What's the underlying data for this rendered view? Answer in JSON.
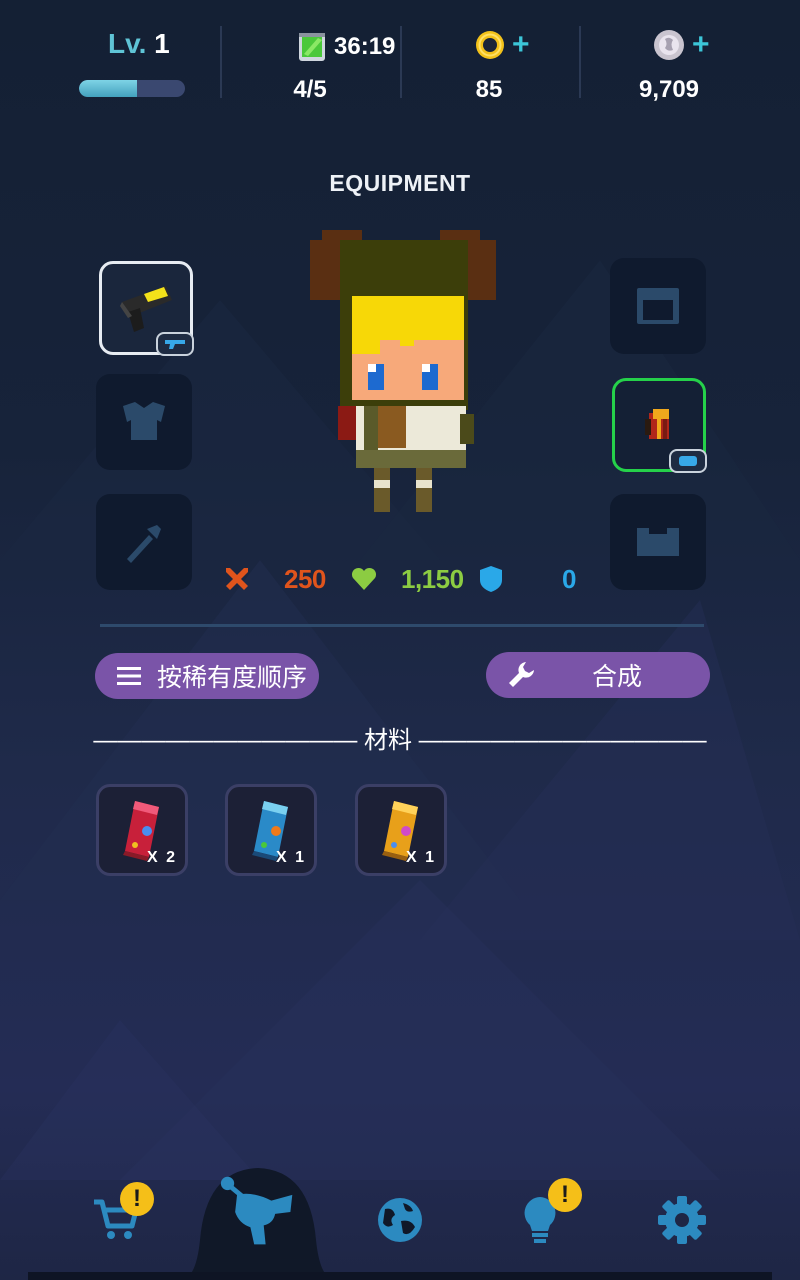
{
  "header": {
    "level_prefix": "Lv.",
    "level_value": "1",
    "xp_progress": 0.55,
    "energy_timer": "36:19",
    "energy_count": "4/5",
    "coins": "85",
    "gems": "9,709",
    "add_symbol": "+"
  },
  "page_title": "EQUIPMENT",
  "equipment": {
    "left_slots": [
      "weapon",
      "armor",
      "accessory"
    ],
    "right_slots": [
      "helmet",
      "backpack",
      "boots"
    ],
    "equipped": [
      "weapon",
      "backpack"
    ]
  },
  "stats": {
    "attack": "250",
    "health": "1,150",
    "defense": "0"
  },
  "buttons": {
    "sort_label": "按稀有度顺序",
    "craft_label": "合成"
  },
  "materials": {
    "title": "——————————— 材料 ————————————",
    "items": [
      {
        "color": "red",
        "count": "X 2"
      },
      {
        "color": "blue",
        "count": "X 1"
      },
      {
        "color": "gold",
        "count": "X 1"
      }
    ]
  },
  "nav": {
    "items": [
      "shop-icon",
      "blaster-icon",
      "globe-icon",
      "lightbulb-icon",
      "gear-icon"
    ],
    "active": "blaster-icon",
    "badge_symbol": "!"
  },
  "colors": {
    "accent_cyan": "#5fc4d6",
    "purple_button": "#7a54a8",
    "attack": "#e0541c",
    "health": "#8ccc42",
    "defense": "#2aa8e8",
    "badge": "#f5bf18",
    "equipped_green": "#25d14a"
  }
}
